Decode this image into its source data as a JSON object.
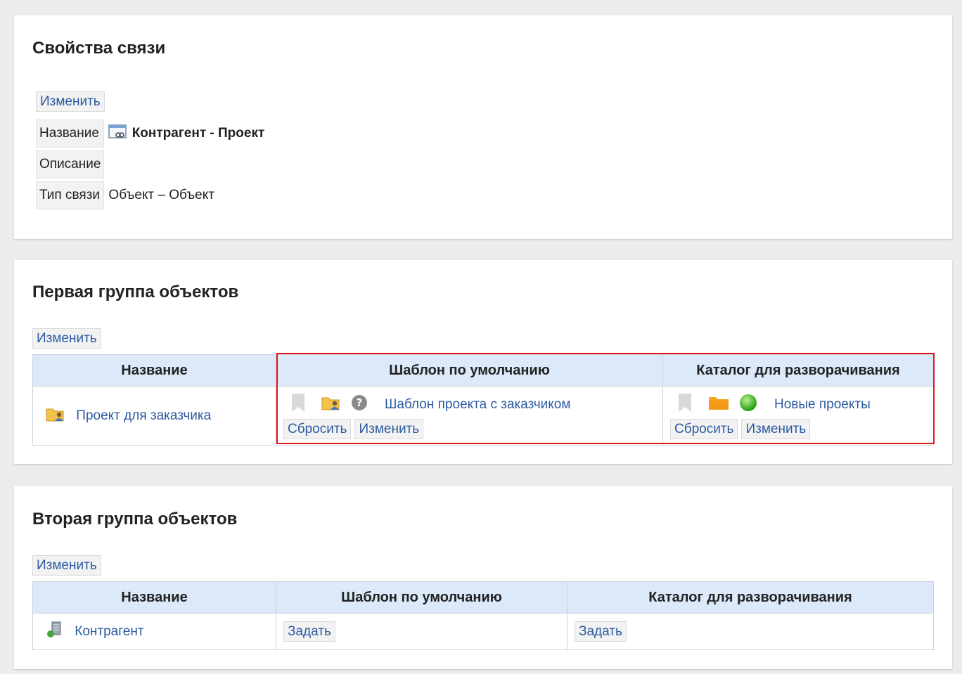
{
  "link_props": {
    "title": "Свойства связи",
    "edit_label": "Изменить",
    "rows": [
      {
        "label": "Название",
        "value": "Контрагент - Проект"
      },
      {
        "label": "Описание",
        "value": ""
      },
      {
        "label": "Тип связи",
        "value": "Объект – Объект"
      }
    ]
  },
  "group1": {
    "title": "Первая группа объектов",
    "edit_label": "Изменить",
    "headers": [
      "Название",
      "Шаблон по умолчанию",
      "Каталог для разворачивания"
    ],
    "row": {
      "name": "Проект для заказчика",
      "template_link": "Шаблон проекта с заказчиком",
      "catalog_link": "Новые проекты",
      "reset_label": "Сбросить",
      "change_label": "Изменить"
    }
  },
  "group2": {
    "title": "Вторая группа объектов",
    "edit_label": "Изменить",
    "headers": [
      "Название",
      "Шаблон по умолчанию",
      "Каталог для разворачивания"
    ],
    "row": {
      "name": "Контрагент",
      "set_label": "Задать"
    }
  },
  "colors": {
    "accent_link": "#2c5aa0",
    "header_bg": "#dbe9f8",
    "highlight": "#e8141c"
  }
}
